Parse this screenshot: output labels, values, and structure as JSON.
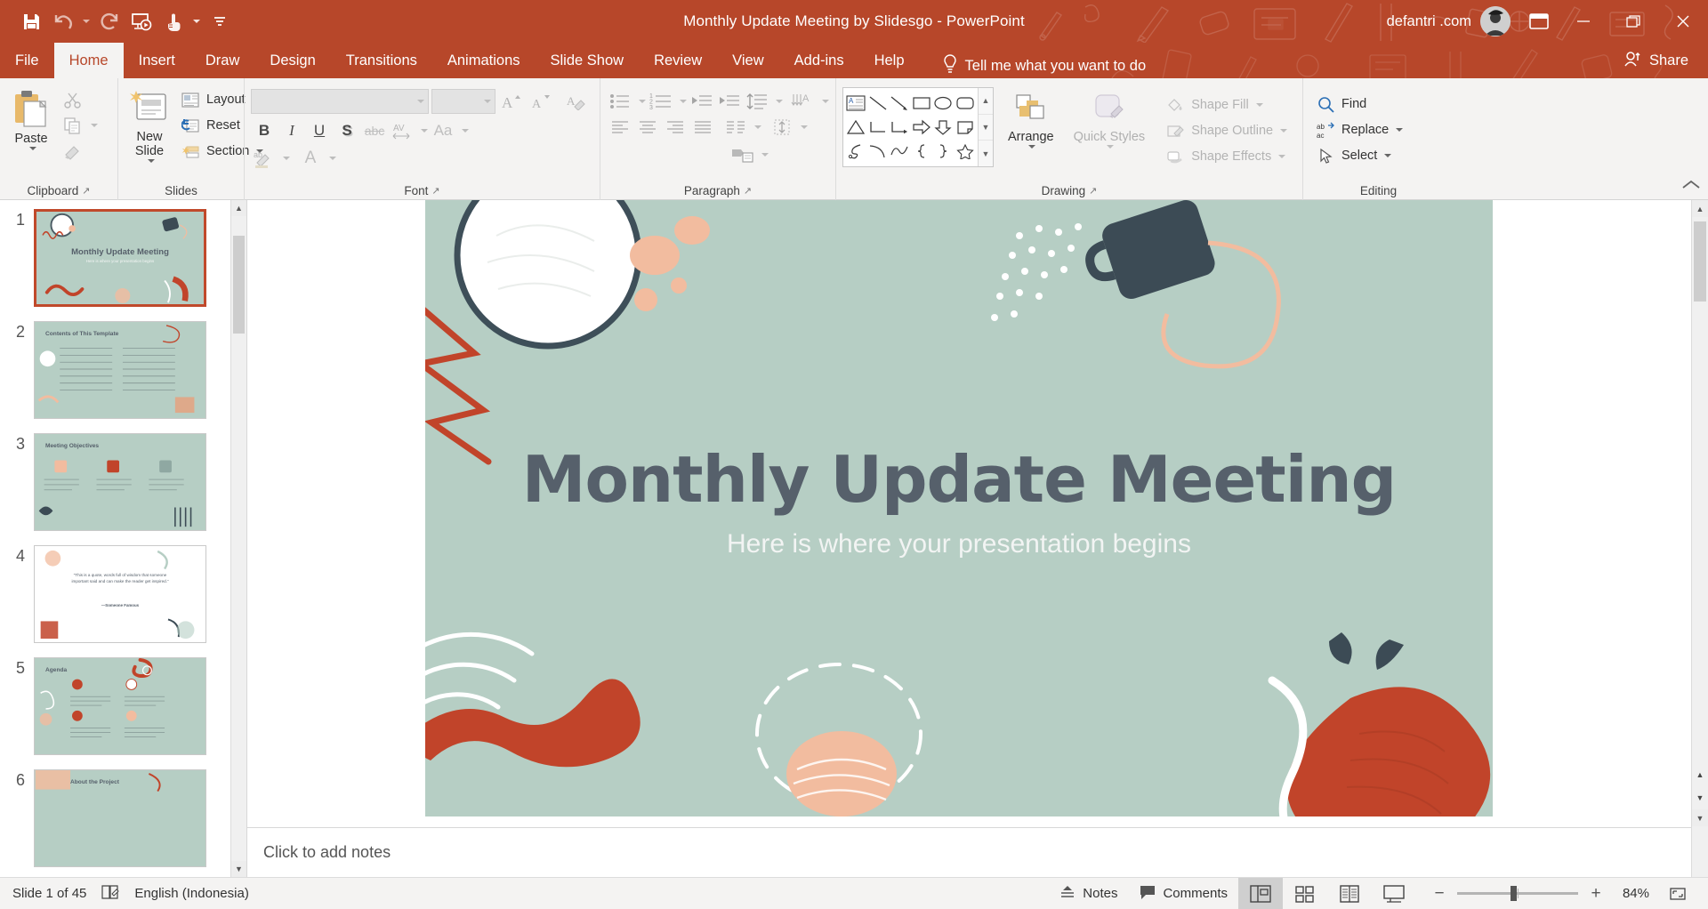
{
  "app": {
    "title": "Monthly Update Meeting by Slidesgo  -  PowerPoint",
    "brand_color": "#b7472a",
    "account": "defantri .com"
  },
  "quick_access": {
    "items": [
      {
        "name": "save-icon",
        "label": "Save"
      },
      {
        "name": "undo-icon",
        "label": "Undo"
      },
      {
        "name": "redo-icon",
        "label": "Redo"
      },
      {
        "name": "start-presentation-icon",
        "label": "Start From Beginning"
      },
      {
        "name": "touch-mode-icon",
        "label": "Touch/Mouse Mode"
      },
      {
        "name": "customize-qat-icon",
        "label": "Customize Quick Access Toolbar"
      }
    ]
  },
  "window_controls": {
    "ribbon_display_options": "Ribbon Display Options",
    "minimize": "Minimize",
    "restore": "Restore Down",
    "close": "Close"
  },
  "tabs": [
    {
      "label": "File",
      "active": false
    },
    {
      "label": "Home",
      "active": true
    },
    {
      "label": "Insert",
      "active": false
    },
    {
      "label": "Draw",
      "active": false
    },
    {
      "label": "Design",
      "active": false
    },
    {
      "label": "Transitions",
      "active": false
    },
    {
      "label": "Animations",
      "active": false
    },
    {
      "label": "Slide Show",
      "active": false
    },
    {
      "label": "Review",
      "active": false
    },
    {
      "label": "View",
      "active": false
    },
    {
      "label": "Add-ins",
      "active": false
    },
    {
      "label": "Help",
      "active": false
    }
  ],
  "tell_me": "Tell me what you want to do",
  "share": "Share",
  "ribbon": {
    "clipboard": {
      "group_label": "Clipboard",
      "paste": "Paste",
      "cut": "Cut",
      "copy": "Copy",
      "format_painter": "Format Painter"
    },
    "slides": {
      "group_label": "Slides",
      "new_slide": "New Slide",
      "layout": "Layout",
      "reset": "Reset",
      "section": "Section"
    },
    "font": {
      "group_label": "Font",
      "font_name_value": "",
      "font_size_value": "",
      "increase_font": "Increase Font Size",
      "decrease_font": "Decrease Font Size",
      "clear_formatting": "Clear All Formatting",
      "bold": "B",
      "italic": "I",
      "underline": "U",
      "shadow": "S",
      "strikethrough": "abc",
      "character_spacing": "AV",
      "change_case": "Aa",
      "text_highlight": "ab",
      "font_color": "A"
    },
    "paragraph": {
      "group_label": "Paragraph",
      "bullets": "Bullets",
      "numbering": "Numbering",
      "decrease_indent": "Decrease List Level",
      "increase_indent": "Increase List Level",
      "line_spacing": "Line Spacing",
      "text_direction": "Text Direction",
      "align_text": "Align Text",
      "align_left": "Align Left",
      "align_center": "Center",
      "align_right": "Align Right",
      "justify": "Justify",
      "columns": "Columns",
      "convert_smartart": "Convert to SmartArt"
    },
    "drawing": {
      "group_label": "Drawing",
      "arrange": "Arrange",
      "quick_styles": "Quick Styles",
      "shape_fill": "Shape Fill",
      "shape_outline": "Shape Outline",
      "shape_effects": "Shape Effects",
      "shapes": [
        "text-box",
        "line",
        "line-arrow",
        "rectangle",
        "oval",
        "rounded-rectangle",
        "triangle",
        "elbow-connector",
        "elbow-arrow-connector",
        "right-arrow",
        "down-arrow",
        "folded-corner",
        "scribble",
        "curve",
        "freeform",
        "left-brace",
        "right-brace",
        "star"
      ]
    },
    "editing": {
      "group_label": "Editing",
      "find": "Find",
      "replace": "Replace",
      "select": "Select"
    },
    "collapse_ribbon": "Collapse the Ribbon"
  },
  "thumbnails": [
    {
      "num": "1",
      "title": "Monthly Update Meeting",
      "subtitle": "Here is where your presentation begins",
      "selected": true,
      "kind": "title"
    },
    {
      "num": "2",
      "title": "Contents of This Template",
      "selected": false,
      "kind": "contents"
    },
    {
      "num": "3",
      "title": "Meeting Objectives",
      "selected": false,
      "kind": "objectives"
    },
    {
      "num": "4",
      "title": "“This is a quote, words full of wisdom that someone important said and can make the reader get inspired.”",
      "byline": "—Someone Famous",
      "selected": false,
      "kind": "quote"
    },
    {
      "num": "5",
      "title": "Agenda",
      "selected": false,
      "kind": "agenda"
    },
    {
      "num": "6",
      "title": "About the Project",
      "selected": false,
      "kind": "about"
    }
  ],
  "slide": {
    "title": "Monthly Update Meeting",
    "subtitle": "Here is where your presentation begins",
    "background_color": "#b6cec4",
    "title_color": "#56606b",
    "accent_red": "#c1442a",
    "accent_peach": "#f2bc9f",
    "accent_dark": "#3c4b55"
  },
  "notes": {
    "placeholder": "Click to add notes"
  },
  "status_bar": {
    "slide_count": "Slide 1 of 45",
    "language": "English (Indonesia)",
    "accessibility_icon": "spell-check-icon",
    "notes": "Notes",
    "comments": "Comments",
    "views": [
      {
        "name": "normal-view",
        "label": "Normal",
        "active": true
      },
      {
        "name": "slide-sorter-view",
        "label": "Slide Sorter",
        "active": false
      },
      {
        "name": "reading-view",
        "label": "Reading View",
        "active": false
      },
      {
        "name": "slide-show-view",
        "label": "Slide Show",
        "active": false
      }
    ],
    "zoom_out": "−",
    "zoom_in": "+",
    "zoom_value": "84%",
    "fit_to_window": "Fit slide to current window"
  }
}
